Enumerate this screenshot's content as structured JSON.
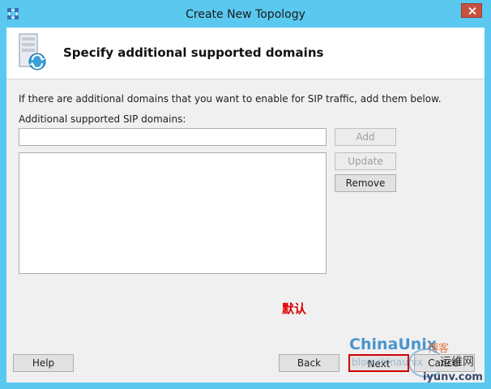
{
  "window": {
    "title": "Create New Topology"
  },
  "header": {
    "title": "Specify additional supported domains"
  },
  "content": {
    "instruction": "If there are additional domains that you want to enable for SIP traffic, add them below.",
    "field_label": "Additional supported SIP domains:",
    "domain_input": {
      "value": "",
      "placeholder": ""
    },
    "domains_list": []
  },
  "buttons": {
    "add": "Add",
    "update": "Update",
    "remove": "Remove",
    "help": "Help",
    "back": "Back",
    "next": "Next",
    "cancel": "Cancel"
  },
  "annotation": {
    "text": "默认",
    "color": "#e00000"
  },
  "watermark": {
    "brand": "ChinaUnix",
    "brand_suffix": "博客",
    "blog_url": "blog.chinaunix",
    "site_name": "运维网",
    "site_url": "iyunv.com"
  },
  "colors": {
    "window_frame": "#5ac8ef",
    "close_button": "#c7503f",
    "highlight_border": "#d00000"
  },
  "icons": {
    "app": "topology-builder-icon",
    "header": "server-sync-icon",
    "close": "close-icon"
  }
}
